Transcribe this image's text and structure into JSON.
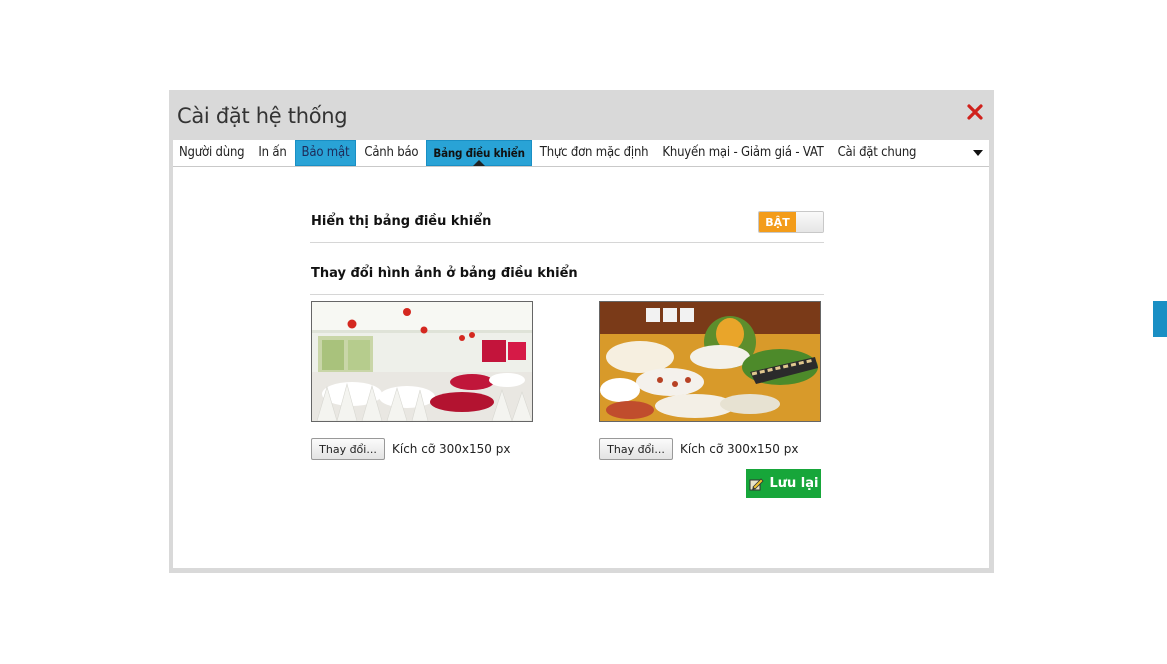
{
  "dialog": {
    "title": "Cài đặt hệ thống"
  },
  "tabs": [
    {
      "label": "Người dùng"
    },
    {
      "label": "In ấn"
    },
    {
      "label": "Bảo mật"
    },
    {
      "label": "Cảnh báo"
    },
    {
      "label": "Bảng điều khiển"
    },
    {
      "label": "Thực đơn mặc định"
    },
    {
      "label": "Khuyến mại - Giảm giá - VAT"
    },
    {
      "label": "Cài đặt chung"
    }
  ],
  "active_tab": "Bảng điều khiển",
  "dashboard": {
    "show_label": "Hiển thị bảng điều khiển",
    "toggle_label": "BẬT",
    "toggle_state": "on",
    "change_images_label": "Thay đổi hình ảnh ở bảng điều khiển",
    "images": [
      {
        "change_button": "Thay đổi...",
        "size_note": "Kích cỡ 300x150 px",
        "description": "banquet hall with white chairs and red lanterns"
      },
      {
        "change_button": "Thay đổi...",
        "size_note": "Kích cỡ 300x150 px",
        "description": "buffet food platters"
      }
    ],
    "save_label": "Lưu lại"
  },
  "colors": {
    "tab_accent": "#29a3d6",
    "toggle_on": "#f39c1a",
    "save_button": "#17a63a",
    "close_icon": "#d0211c"
  }
}
